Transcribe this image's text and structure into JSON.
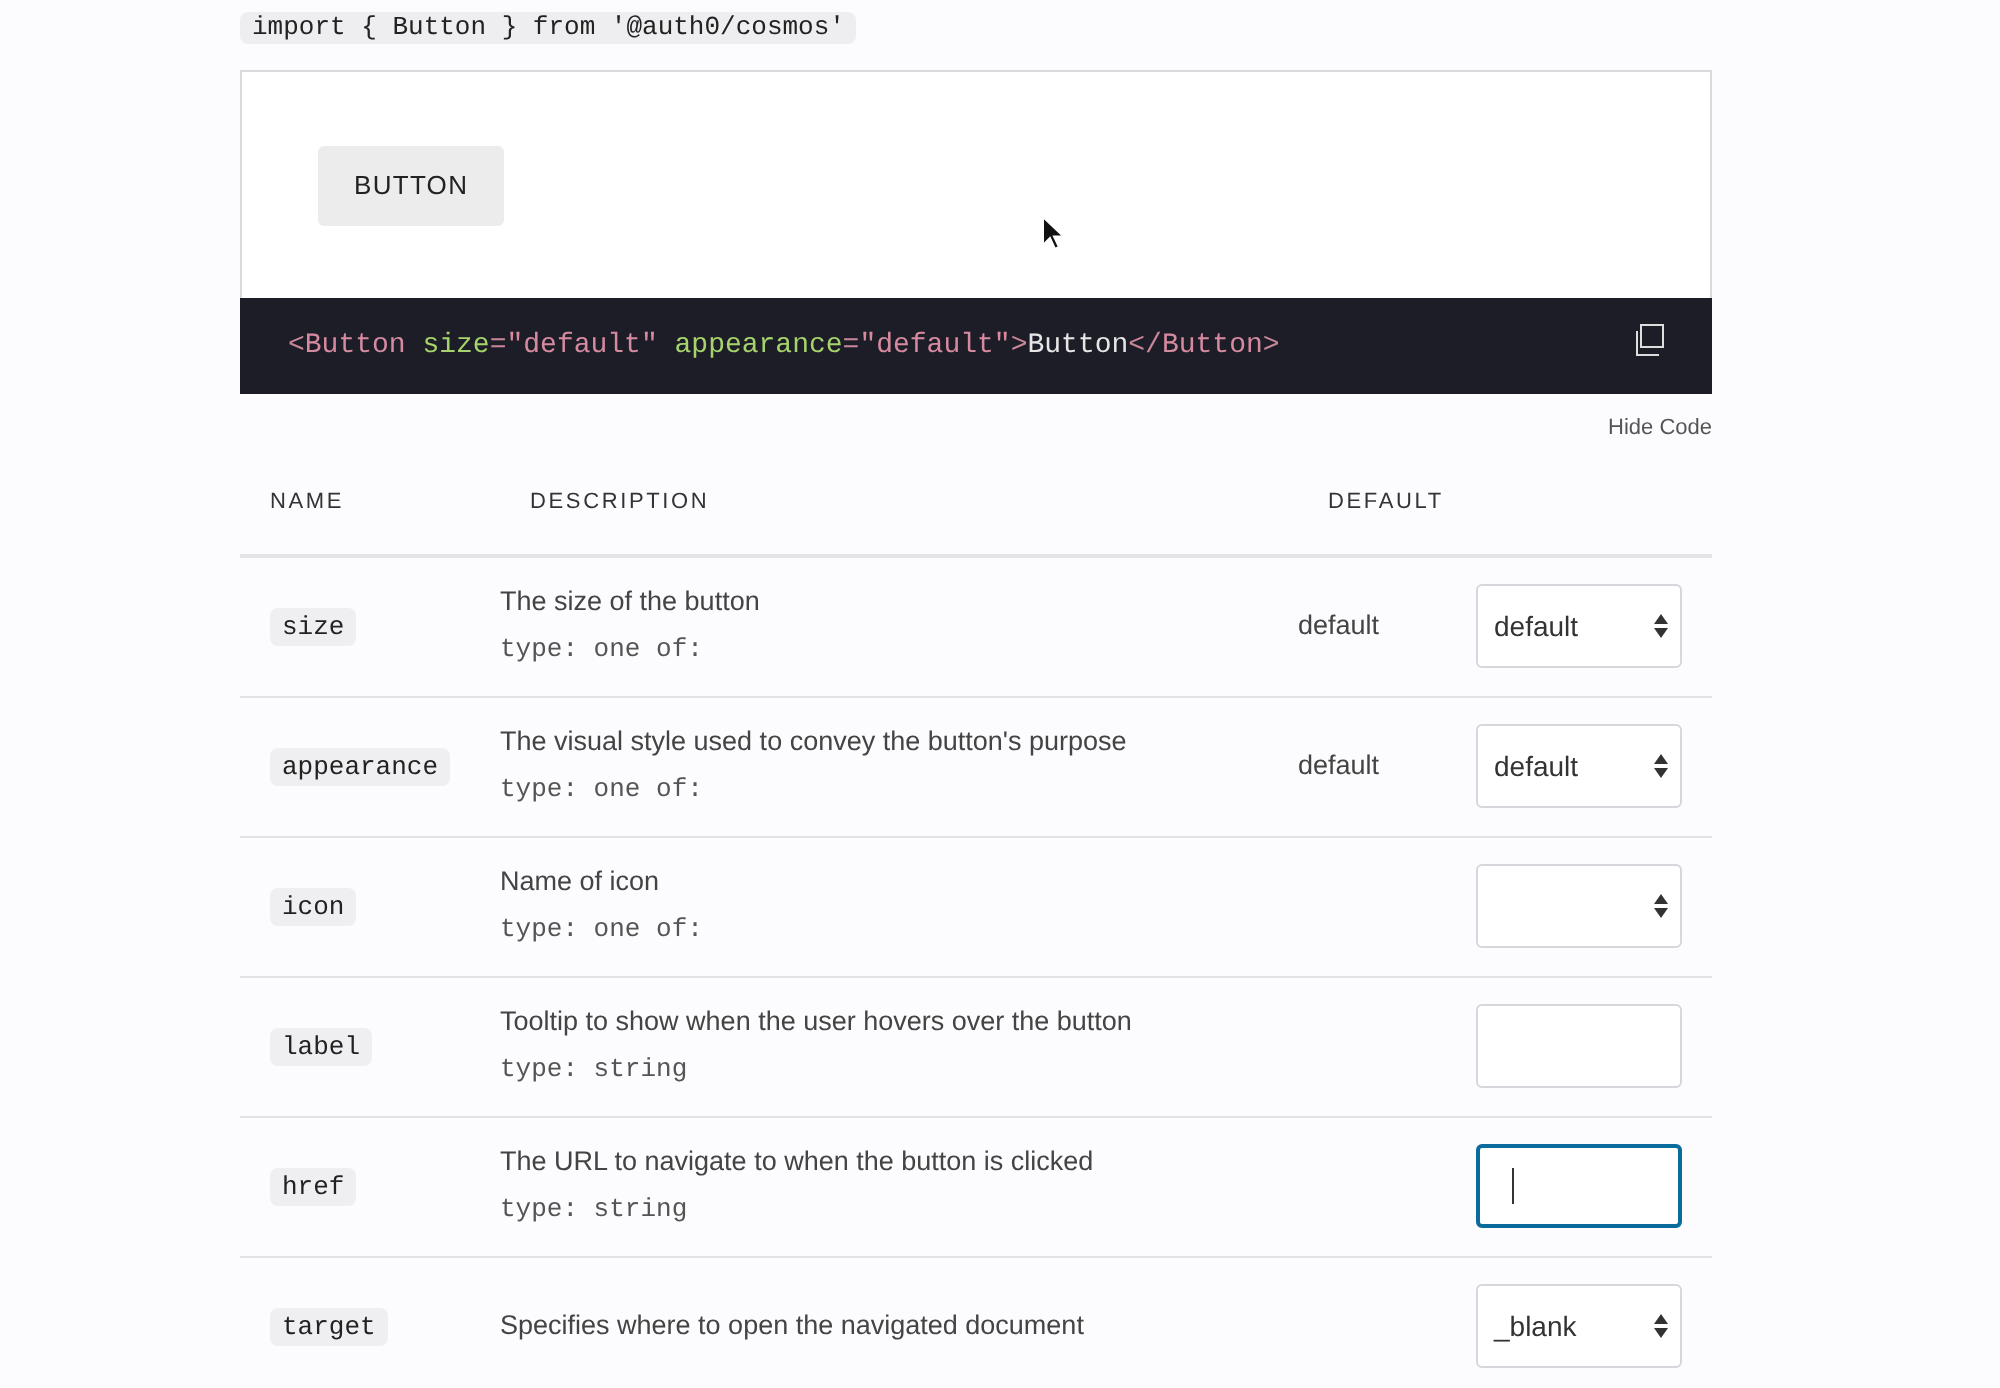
{
  "import_code": "import { Button } from '@auth0/cosmos'",
  "preview": {
    "button_label": "BUTTON"
  },
  "code": [
    {
      "kind": "punct",
      "text": "<"
    },
    {
      "kind": "tag",
      "text": "Button"
    },
    {
      "kind": "attr",
      "text": " size"
    },
    {
      "kind": "punct",
      "text": "="
    },
    {
      "kind": "string",
      "text": "\"default\""
    },
    {
      "kind": "attr",
      "text": " appearance"
    },
    {
      "kind": "punct",
      "text": "="
    },
    {
      "kind": "string",
      "text": "\"default\""
    },
    {
      "kind": "punct",
      "text": ">"
    },
    {
      "kind": "plain",
      "text": "Button"
    },
    {
      "kind": "punct",
      "text": "</"
    },
    {
      "kind": "tag",
      "text": "Button"
    },
    {
      "kind": "punct",
      "text": ">"
    }
  ],
  "hide_code": "Hide Code",
  "table": {
    "columns": [
      "NAME",
      "DESCRIPTION",
      "DEFAULT"
    ],
    "rows": [
      {
        "name": "size",
        "description": "The size of the button",
        "type": "type: one of:",
        "default": "default",
        "control": {
          "kind": "select",
          "value": "default",
          "focused": false
        }
      },
      {
        "name": "appearance",
        "description": "The visual style used to convey the button's purpose",
        "type": "type: one of:",
        "default": "default",
        "control": {
          "kind": "select",
          "value": "default",
          "focused": false
        }
      },
      {
        "name": "icon",
        "description": "Name of icon",
        "type": "type: one of:",
        "control": {
          "kind": "select",
          "focused": false
        }
      },
      {
        "name": "label",
        "description": "Tooltip to show when the user hovers over the button",
        "type": "type: string",
        "control": {
          "kind": "input",
          "focused": false
        }
      },
      {
        "name": "href",
        "description": "The URL to navigate to when the button is clicked",
        "type": "type: string",
        "control": {
          "kind": "input",
          "focused": true
        }
      },
      {
        "name": "target",
        "description": "Specifies where to open the navigated document",
        "control": {
          "kind": "select",
          "value": "_blank",
          "focused": false
        }
      }
    ]
  }
}
